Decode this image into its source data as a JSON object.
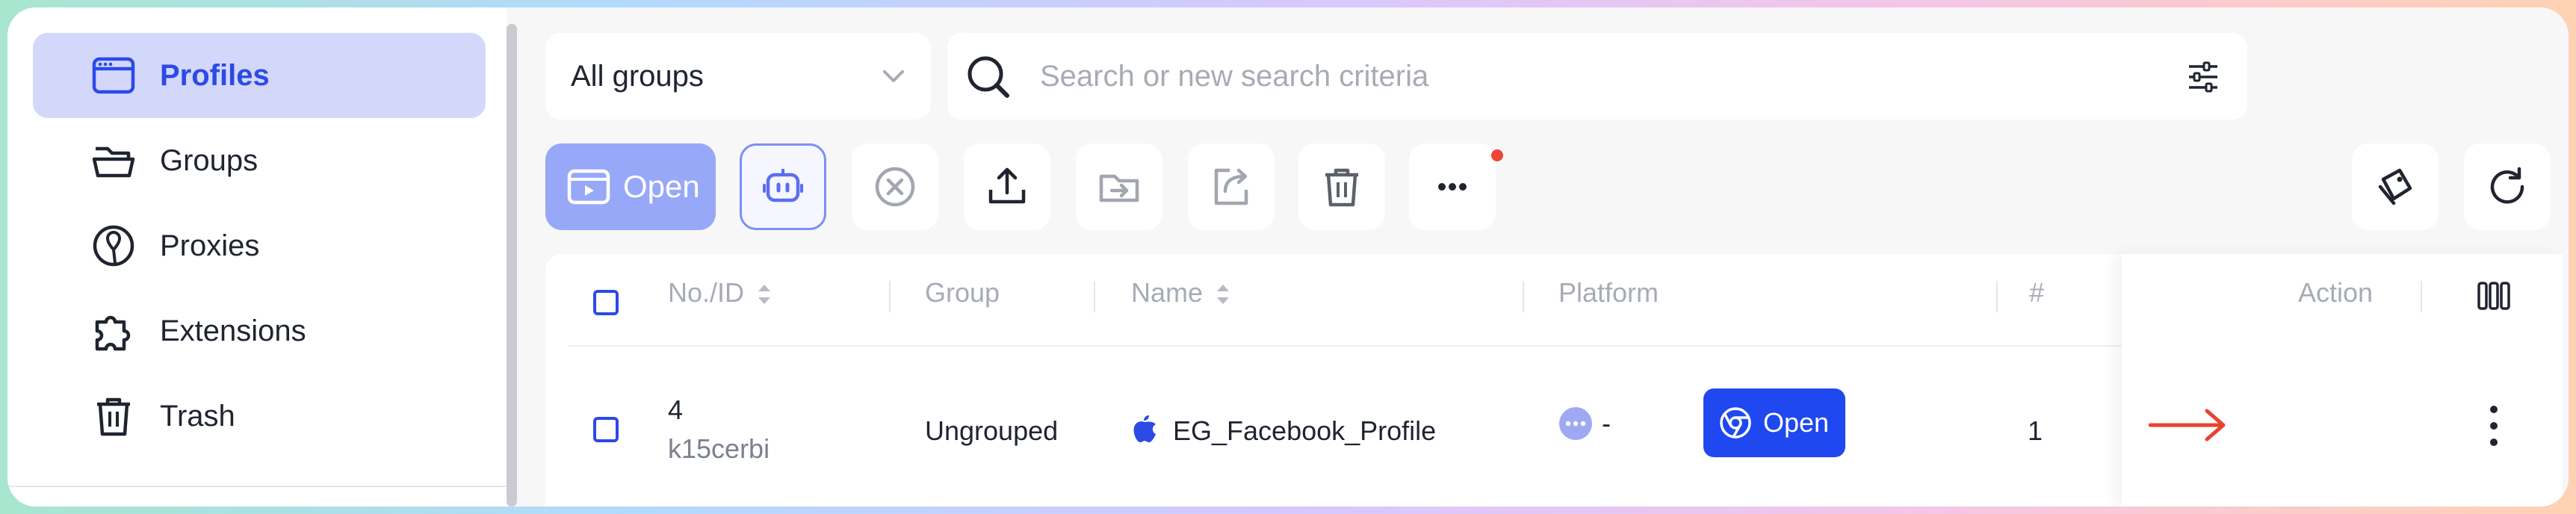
{
  "sidebar": {
    "items": [
      {
        "label": "Profiles",
        "icon": "window-icon",
        "active": true
      },
      {
        "label": "Groups",
        "icon": "folder-icon",
        "active": false
      },
      {
        "label": "Proxies",
        "icon": "location-pin-icon",
        "active": false
      },
      {
        "label": "Extensions",
        "icon": "puzzle-icon",
        "active": false
      },
      {
        "label": "Trash",
        "icon": "trash-icon",
        "active": false
      }
    ]
  },
  "toolbar": {
    "group_select": "All groups",
    "search_placeholder": "Search or new search criteria",
    "open_label": "Open"
  },
  "table": {
    "columns": [
      "No./ID",
      "Group",
      "Name",
      "Platform",
      "#",
      "Action"
    ],
    "rows": [
      {
        "no": "4",
        "id": "k15cerbi",
        "group": "Ungrouped",
        "name": "EG_Facebook_Profile",
        "platform": "-",
        "count": "1",
        "action": "Open"
      }
    ]
  },
  "colors": {
    "accent": "#2b4ae6",
    "active_bg": "#d3d8fb",
    "primary_button": "#1f48f0",
    "notification_dot": "#f04438",
    "annotation_arrow": "#e8432f"
  }
}
